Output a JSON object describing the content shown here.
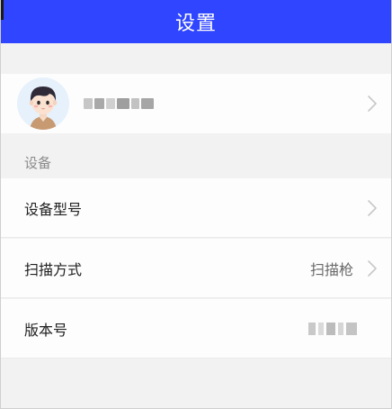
{
  "header": {
    "title": "设置"
  },
  "profile": {
    "avatar_icon": "boy-avatar-icon",
    "username_redacted": true
  },
  "sections": {
    "device": {
      "label": "设备",
      "rows": [
        {
          "label": "设备型号",
          "value": ""
        },
        {
          "label": "扫描方式",
          "value": "扫描枪"
        },
        {
          "label": "版本号",
          "value_redacted": true
        }
      ]
    }
  },
  "colors": {
    "header_bg": "#2f45ff",
    "page_bg": "#f2f2f2",
    "row_bg": "#fdfdfd",
    "chevron": "#c8c8c8"
  }
}
